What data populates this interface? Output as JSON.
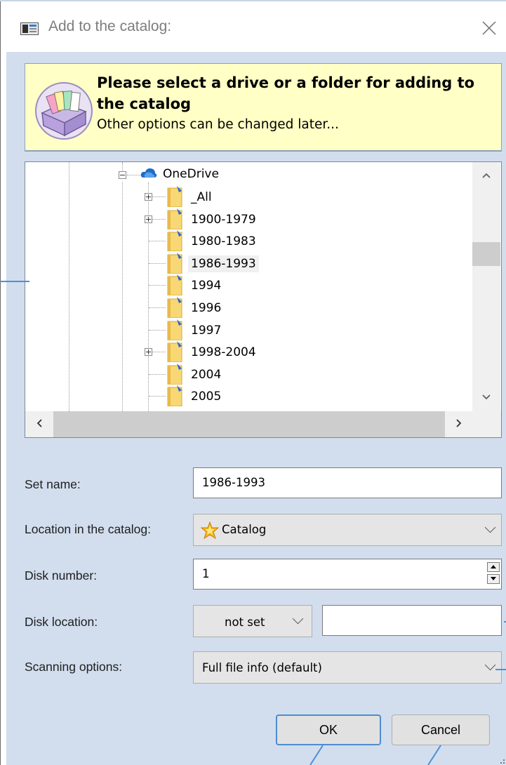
{
  "window": {
    "title": "Add to the catalog:",
    "icons": {
      "app": "dialog-app-icon",
      "close": "close-icon"
    }
  },
  "header": {
    "title": "Please select a drive or a folder for adding to the catalog",
    "subtitle": "Other options can be changed later...",
    "icon": "catalog-box-icon"
  },
  "tree": {
    "root": {
      "label": "OneDrive",
      "icon": "onedrive-cloud-icon",
      "expanded": true
    },
    "items": [
      {
        "label": "_All",
        "expandable": true,
        "selected": false
      },
      {
        "label": "1900-1979",
        "expandable": true,
        "selected": false
      },
      {
        "label": "1980-1983",
        "expandable": false,
        "selected": false
      },
      {
        "label": "1986-1993",
        "expandable": false,
        "selected": true
      },
      {
        "label": "1994",
        "expandable": false,
        "selected": false
      },
      {
        "label": "1996",
        "expandable": false,
        "selected": false
      },
      {
        "label": "1997",
        "expandable": false,
        "selected": false
      },
      {
        "label": "1998-2004",
        "expandable": true,
        "selected": false
      },
      {
        "label": "2004",
        "expandable": false,
        "selected": false
      },
      {
        "label": "2005",
        "expandable": false,
        "selected": false
      }
    ]
  },
  "form": {
    "set_name": {
      "label": "Set name:",
      "value": "1986-1993"
    },
    "location": {
      "label": "Location in the catalog:",
      "value": "Catalog",
      "icon": "catalog-star-icon"
    },
    "disk_number": {
      "label": "Disk number:",
      "value": "1"
    },
    "disk_location": {
      "label": "Disk location:",
      "value": "not set",
      "text": ""
    },
    "scanning": {
      "label": "Scanning options:",
      "value": "Full file info (default)"
    }
  },
  "buttons": {
    "ok": "OK",
    "cancel": "Cancel"
  },
  "colors": {
    "client_bg": "#d2deee",
    "header_bg": "#ffffc6",
    "default_button_border": "#4e8ccf",
    "annotation_line": "#4a90d9"
  }
}
